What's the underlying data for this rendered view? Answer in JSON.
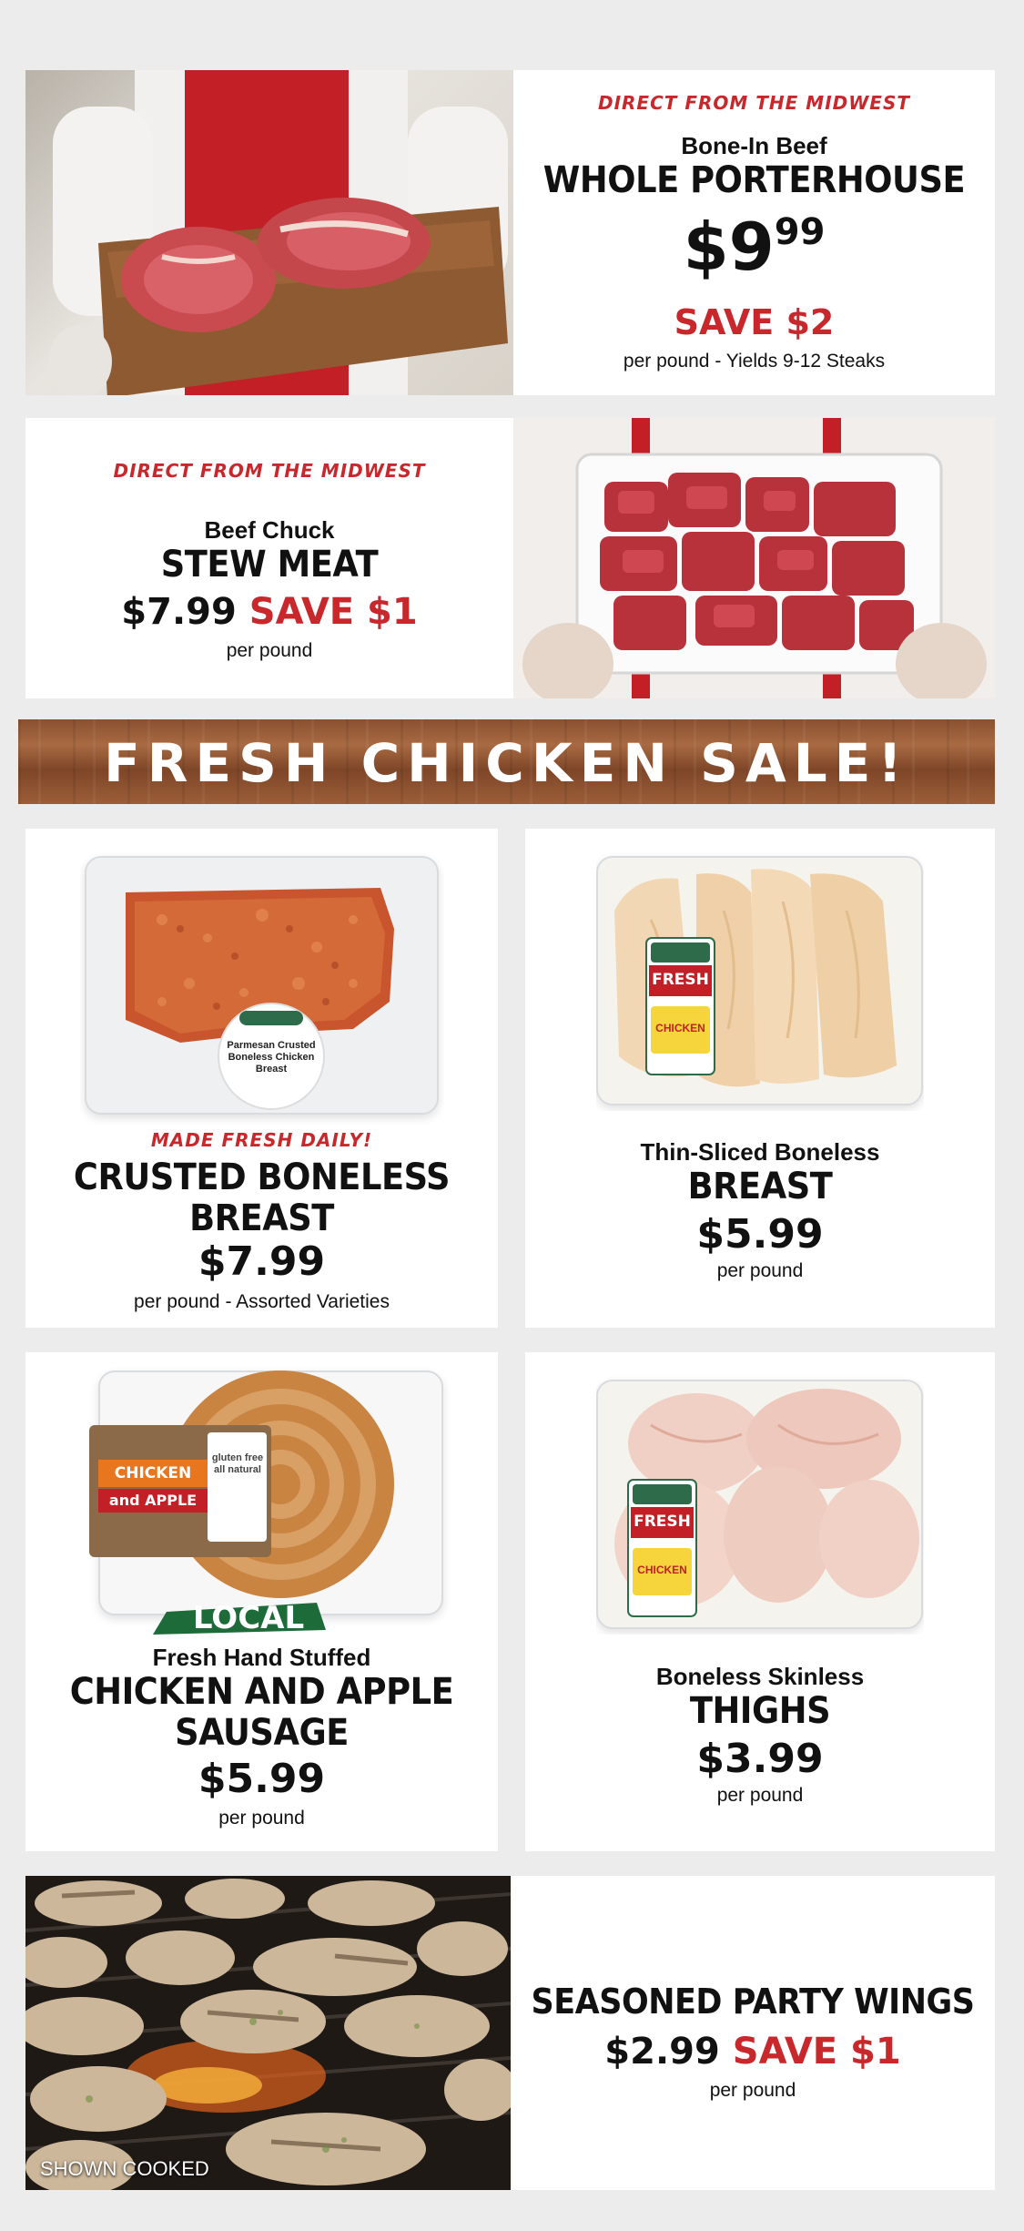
{
  "porterhouse": {
    "tag": "DIRECT FROM THE MIDWEST",
    "subtitle": "Bone-In Beef",
    "title": "WHOLE PORTERHOUSE",
    "price_dollars": "$9",
    "price_cents": "99",
    "save": "SAVE $2",
    "note": "per pound - Yields 9-12 Steaks"
  },
  "stew": {
    "tag": "DIRECT FROM THE MIDWEST",
    "subtitle": "Beef Chuck",
    "title": "STEW MEAT",
    "price": "$7.99",
    "save": "SAVE $1",
    "note": "per pound"
  },
  "banner": {
    "text": "FRESH CHICKEN SALE!"
  },
  "crusted": {
    "tag": "MADE FRESH DAILY!",
    "title_line1": "CRUSTED BONELESS",
    "title_line2": "BREAST",
    "price": "$7.99",
    "note": "per pound - Assorted Varieties",
    "package_label": "Parmesan Crusted Boneless Chicken Breast"
  },
  "thin_sliced": {
    "subtitle": "Thin-Sliced Boneless",
    "title": "BREAST",
    "price": "$5.99",
    "note": "per pound",
    "label_top": "FRESH",
    "label_bottom": "CHICKEN"
  },
  "sausage": {
    "badge": "LOCAL",
    "subtitle": "Fresh Hand Stuffed",
    "title_line1": "CHICKEN AND APPLE",
    "title_line2": "SAUSAGE",
    "price": "$5.99",
    "note": "per pound",
    "label_line1": "CHICKEN",
    "label_line2": "and APPLE",
    "label_side": "gluten free all natural"
  },
  "thighs": {
    "subtitle": "Boneless Skinless",
    "title": "THIGHS",
    "price": "$3.99",
    "note": "per pound",
    "label_top": "FRESH",
    "label_bottom": "CHICKEN"
  },
  "wings": {
    "title": "SEASONED PARTY WINGS",
    "price": "$2.99",
    "save": "SAVE $1",
    "note": "per pound",
    "photo_caption": "SHOWN COOKED"
  },
  "colors": {
    "accent_red": "#c8282c",
    "wood_brown": "#8a5030",
    "background": "#ececec"
  }
}
